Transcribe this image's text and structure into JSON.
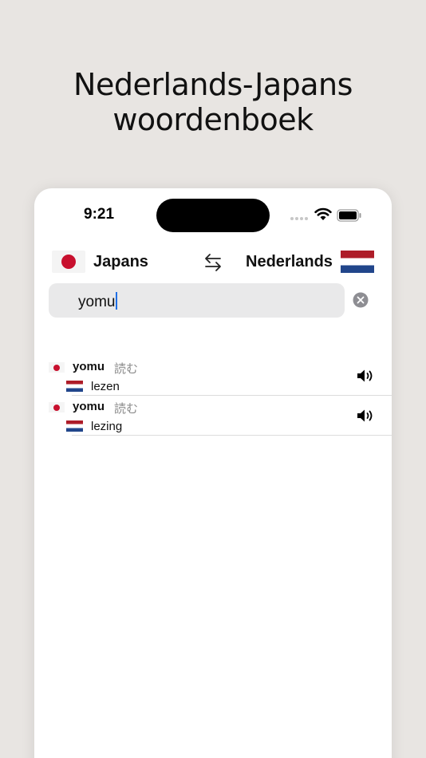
{
  "headline": {
    "line1": "Nederlands-Japans",
    "line2": "woordenboek"
  },
  "status_bar": {
    "time": "9:21"
  },
  "language_bar": {
    "source_language": "Japans",
    "target_language": "Nederlands",
    "source_flag": "japan-flag",
    "target_flag": "netherlands-flag",
    "swap_icon": "swap-arrows-icon"
  },
  "search": {
    "value": "yomu",
    "clear_icon": "clear-circle-icon"
  },
  "results": [
    {
      "romaji": "yomu",
      "kanji": "読む",
      "translation": "lezen"
    },
    {
      "romaji": "yomu",
      "kanji": "読む",
      "translation": "lezing"
    }
  ],
  "colors": {
    "background": "#e8e5e2",
    "accent_caret": "#1f6fe5",
    "japan_red": "#c8102e",
    "nl_red": "#ae1c28",
    "nl_blue": "#21468b"
  }
}
